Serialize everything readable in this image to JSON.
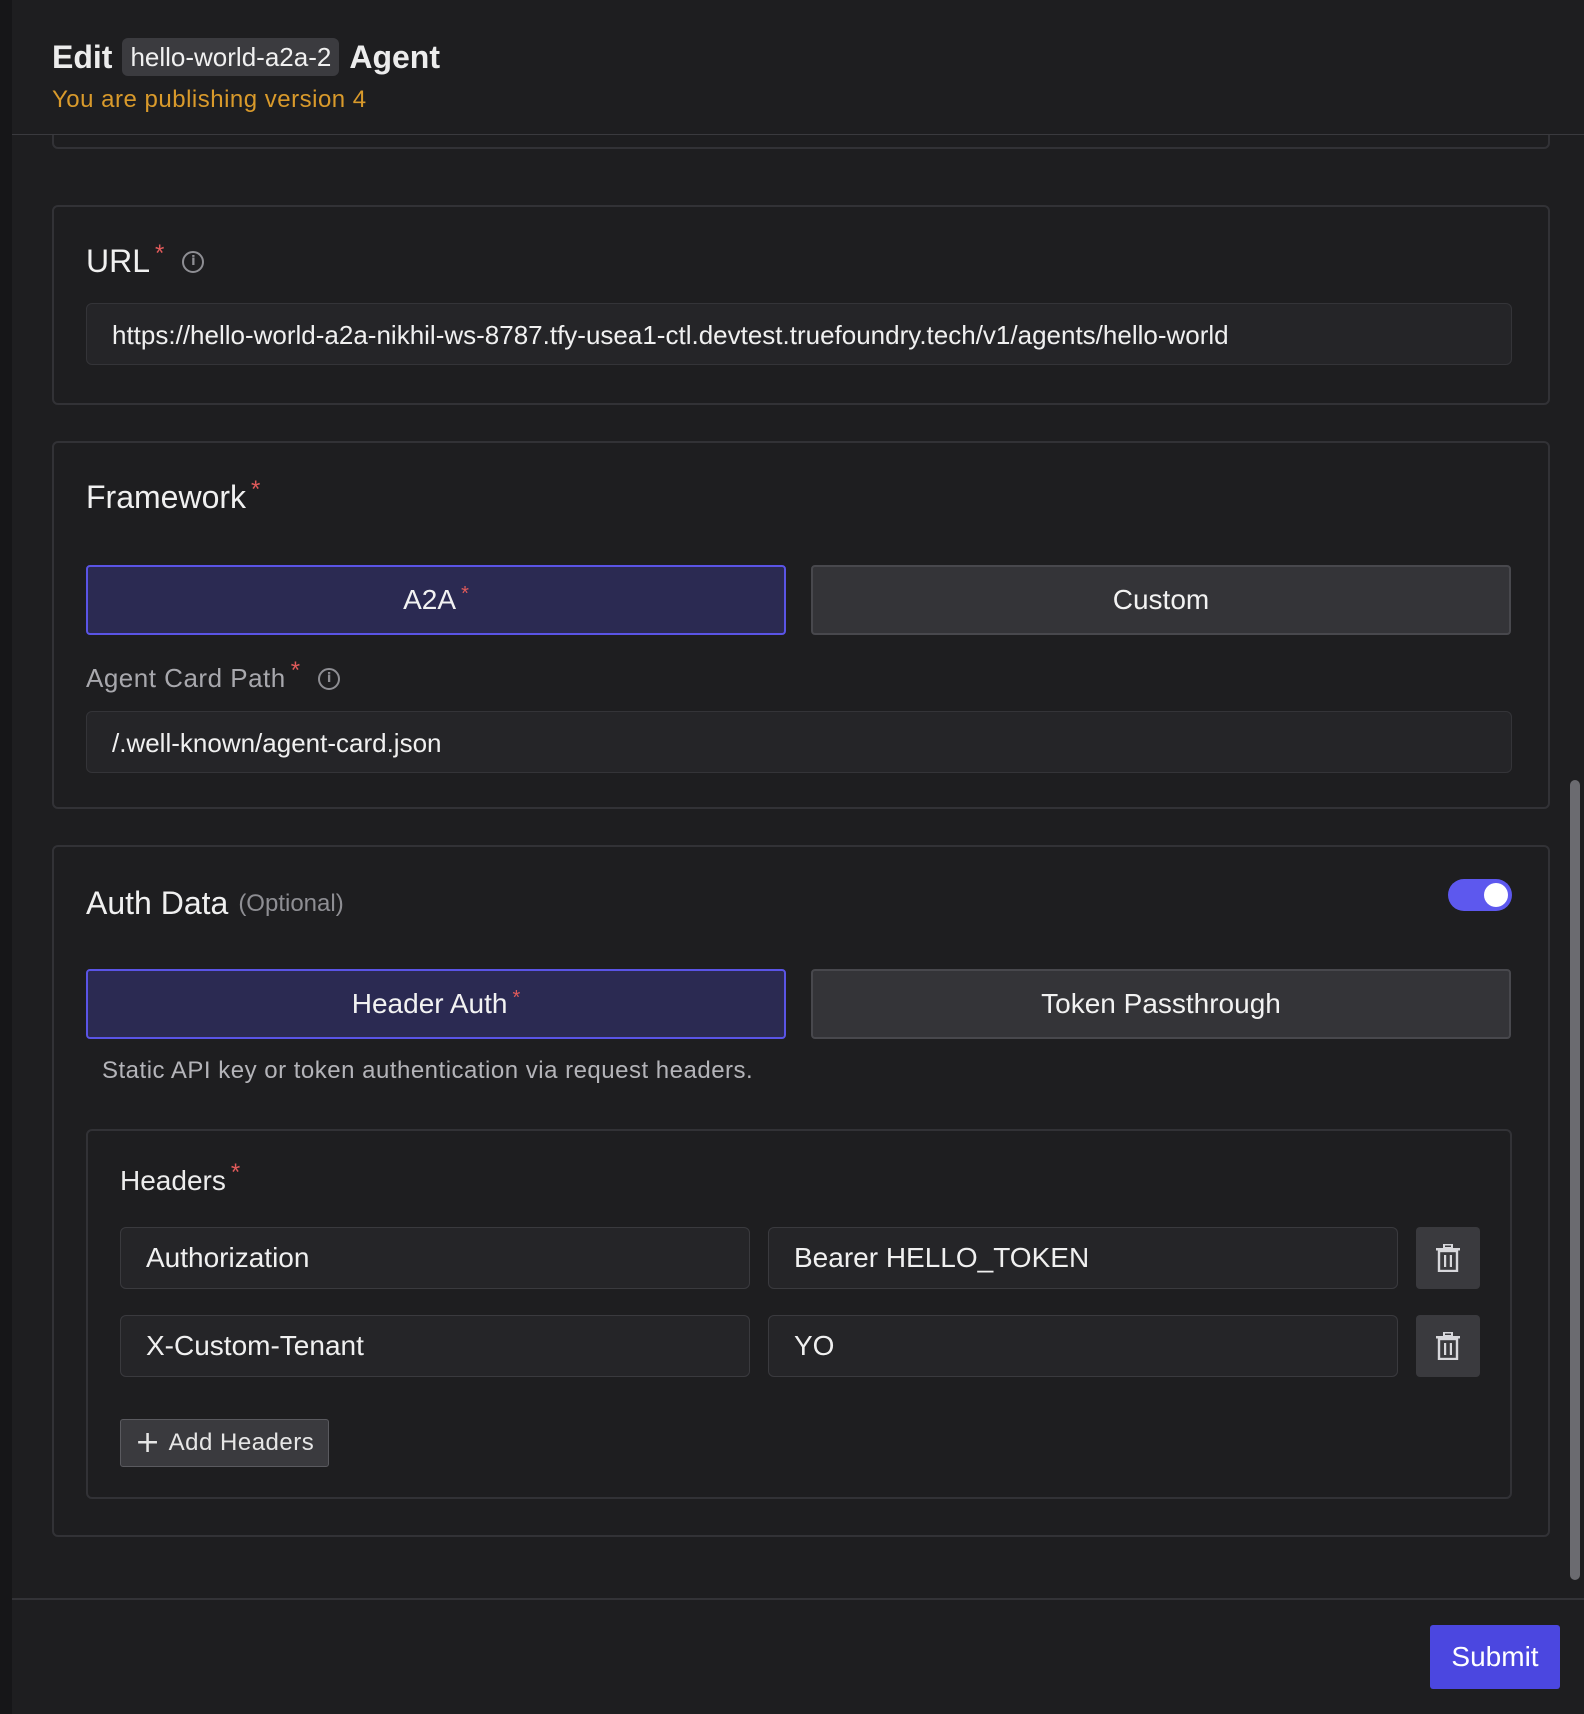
{
  "header": {
    "edit_word": "Edit",
    "agent_name": "hello-world-a2a-2",
    "agent_word": "Agent",
    "subtitle": "You are publishing version 4"
  },
  "url_section": {
    "label": "URL",
    "required_mark": "*",
    "value": "https://hello-world-a2a-nikhil-ws-8787.tfy-usea1-ctl.devtest.truefoundry.tech/v1/agents/hello-world"
  },
  "framework_section": {
    "label": "Framework",
    "required_mark": "*",
    "options": [
      {
        "label": "A2A",
        "selected": true
      },
      {
        "label": "Custom",
        "selected": false
      }
    ],
    "agent_card_path_label": "Agent Card Path",
    "agent_card_path_value": "/.well-known/agent-card.json"
  },
  "auth_section": {
    "label": "Auth Data",
    "optional_text": "(Optional)",
    "toggle_on": true,
    "options": [
      {
        "label": "Header Auth",
        "selected": true
      },
      {
        "label": "Token Passthrough",
        "selected": false
      }
    ],
    "hint": "Static API key or token authentication via request headers.",
    "headers_label": "Headers",
    "headers": [
      {
        "key": "Authorization",
        "value": "Bearer HELLO_TOKEN"
      },
      {
        "key": "X-Custom-Tenant",
        "value": "YO"
      }
    ],
    "add_headers_label": "Add Headers"
  },
  "footer": {
    "submit_label": "Submit"
  },
  "colors": {
    "accent": "#4b47e0",
    "selected_border": "#5a54e6",
    "warning_text": "#d99a2b",
    "required": "#e05a5a"
  },
  "icons": [
    "info-icon",
    "trash-icon",
    "plus-icon"
  ]
}
